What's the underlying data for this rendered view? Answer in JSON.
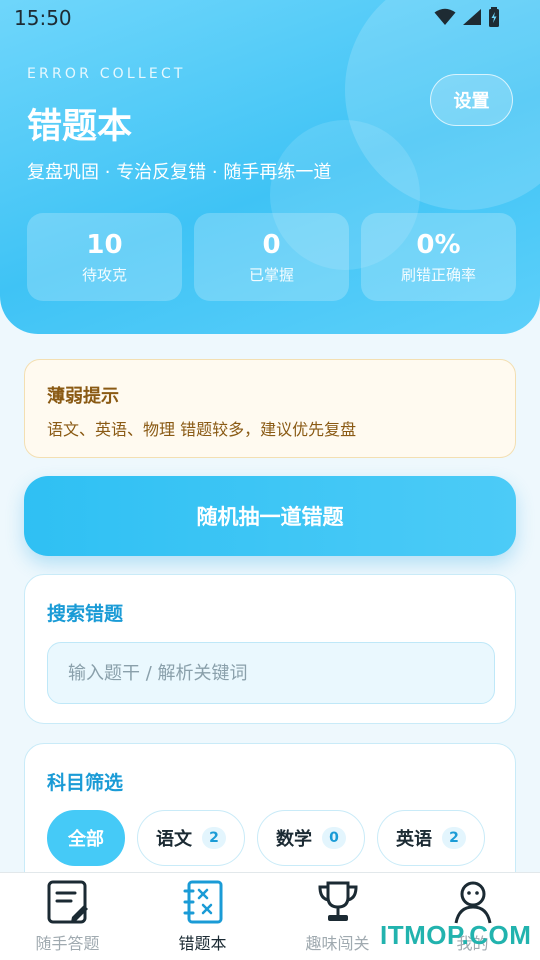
{
  "status_bar": {
    "time": "15:50"
  },
  "header": {
    "en_title": "ERROR COLLECT",
    "title": "错题本",
    "settings_label": "设置",
    "tagline": "复盘巩固 · 专治反复错 · 随手再练一道"
  },
  "stats": [
    {
      "value": "10",
      "label": "待攻克"
    },
    {
      "value": "0",
      "label": "已掌握"
    },
    {
      "value": "0%",
      "label": "刷错正确率"
    }
  ],
  "hint": {
    "title": "薄弱提示",
    "text": "语文、英语、物理 错题较多，建议优先复盘"
  },
  "random_button": "随机抽一道错题",
  "search": {
    "title": "搜索错题",
    "placeholder": "输入题干 / 解析关键词",
    "value": ""
  },
  "subjects": {
    "title": "科目筛选",
    "chips": [
      {
        "label": "全部",
        "count": ""
      },
      {
        "label": "语文",
        "count": "2"
      },
      {
        "label": "数学",
        "count": "0"
      },
      {
        "label": "英语",
        "count": "2"
      }
    ]
  },
  "nav": [
    {
      "label": "随手答题",
      "icon": "note-edit-icon"
    },
    {
      "label": "错题本",
      "icon": "error-book-icon"
    },
    {
      "label": "趣味闯关",
      "icon": "trophy-icon"
    },
    {
      "label": "我的",
      "icon": "profile-icon"
    }
  ],
  "watermark": "ITMOP.COM",
  "colors": {
    "accent": "#45caf7",
    "title_blue": "#1a9bd6",
    "hint_text": "#8a5a14"
  }
}
